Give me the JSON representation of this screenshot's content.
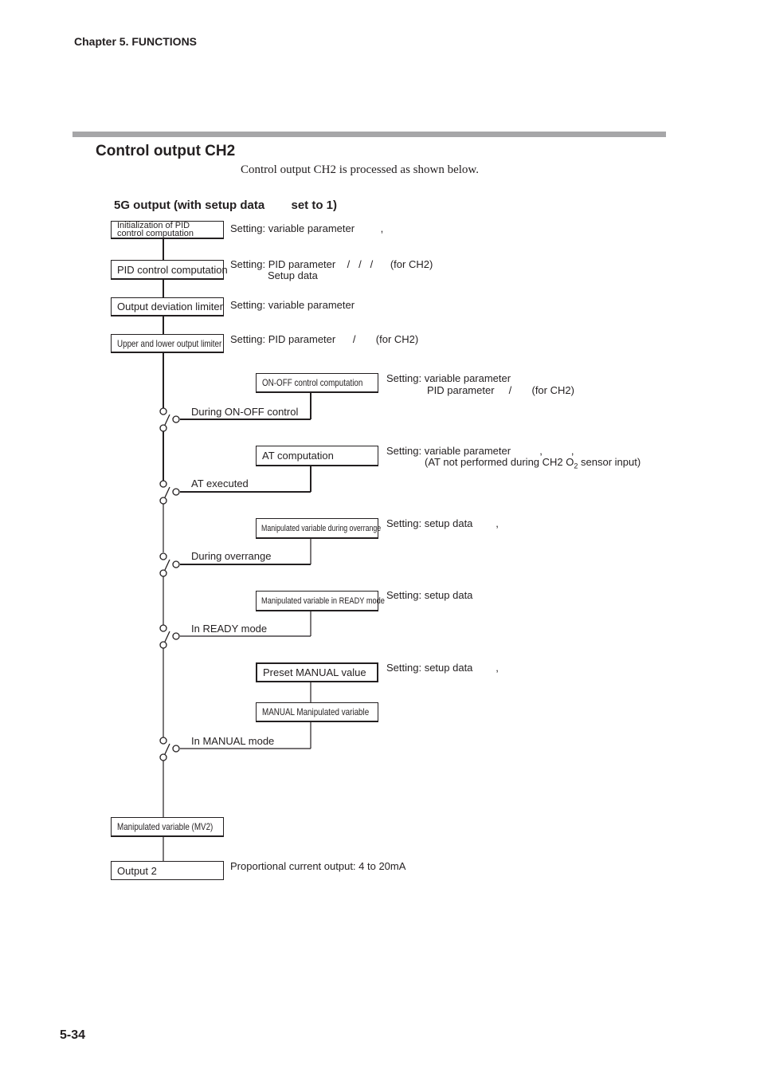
{
  "header": {
    "chapter": "Chapter 5. FUNCTIONS"
  },
  "section": {
    "title": "Control output CH2",
    "intro": "Control output CH2 is processed as shown below.",
    "subtitle": "5G output (with setup data        set to 1)"
  },
  "diagram": {
    "main_blocks": [
      {
        "label_line1": "Initialization of PID",
        "label_line2": "control computation",
        "note": "Setting: variable parameter         ,"
      },
      {
        "label": "PID control computation",
        "note_line1": "Setting: PID parameter    /   /   /      (for CH2)",
        "note_line2": "Setup data"
      },
      {
        "label": "Output deviation limiter",
        "note": "Setting: variable parameter"
      },
      {
        "label": "Upper and lower output limiter",
        "note": "Setting: PID parameter      /       (for CH2)"
      }
    ],
    "branches": [
      {
        "block": "ON-OFF control computation",
        "note_line1": "Setting: variable parameter",
        "note_line2": "PID parameter     /       (for CH2)",
        "switch_label": "During ON-OFF control"
      },
      {
        "block": "AT computation",
        "note_line1": "Setting: variable parameter          ,          ,",
        "note_line2": "(AT not performed during CH2 O",
        "note_sub": "2",
        "note_line2_tail": " sensor input)",
        "switch_label": "AT executed"
      },
      {
        "block": "Manipulated variable during overrange",
        "note_line1": "Setting: setup data        ,",
        "switch_label": "During overrange"
      },
      {
        "block": "Manipulated variable in READY mode",
        "note_line1": "Setting: setup data",
        "switch_label": "In READY mode"
      },
      {
        "block": "Preset MANUAL value",
        "block2": "MANUAL Manipulated variable",
        "note_line1": "Setting: setup data        ,",
        "switch_label": "In MANUAL mode"
      }
    ],
    "final_blocks": [
      {
        "label": "Manipulated variable (MV2)"
      },
      {
        "label": "Output 2",
        "note": "Proportional current output: 4 to 20mA"
      }
    ]
  },
  "footer": {
    "page_number": "5-34"
  }
}
